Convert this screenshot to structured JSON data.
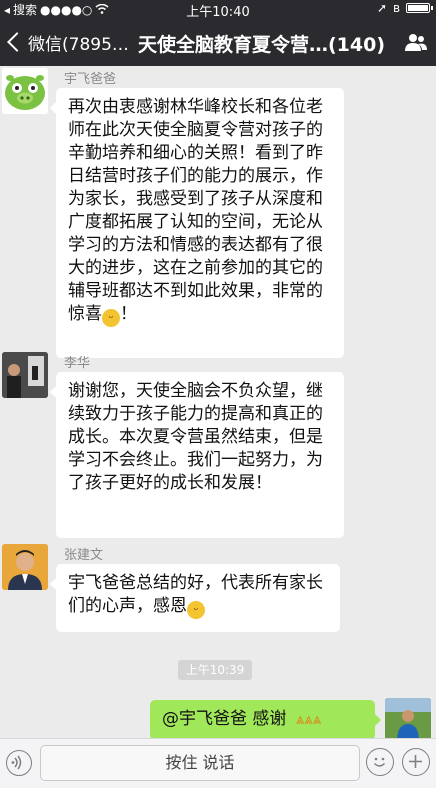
{
  "status_bar": {
    "carrier": "搜索",
    "signal": "●●●●○",
    "time": "上午10:40",
    "battery_percent": 100
  },
  "nav": {
    "back_label": "微信(7895…",
    "title": "天使全脑教育夏令营…(140)",
    "people_icon": "group-people-icon"
  },
  "messages": [
    {
      "sender": "宇飞爸爸",
      "text": "再次由衷感谢林华峰校长和各位老师在此次天使全脑夏令营对孩子的辛勤培养和细心的关照！看到了昨日结营时孩子们的能力的展示，作为家长，我感受到了孩子从深度和广度都拓展了认知的空间，无论从学习的方法和情感的表达都有了很大的进步，这在之前参加的其它的辅导班都达不到如此效果，非常的惊喜",
      "text_end": "！"
    },
    {
      "sender": "李华",
      "text": "谢谢您，天使全脑会不负众望，继续致力于孩子能力的提高和真正的成长。本次夏令营虽然结束，但是学习不会终止。我们一起努力，为了孩子更好的成长和发展！"
    },
    {
      "sender": "张建文",
      "text": "宇飞爸爸总结的好，代表所有家长们的心声，感恩"
    }
  ],
  "time_divider": "上午10:39",
  "my_message": {
    "text": "@宇飞爸爸 感谢"
  },
  "input_bar": {
    "hold_to_talk": "按住 说话"
  },
  "colors": {
    "header_bg": "#2b2b2f",
    "chat_bg": "#ebebeb",
    "my_bubble": "#a0e75a",
    "their_bubble": "#ffffff"
  }
}
